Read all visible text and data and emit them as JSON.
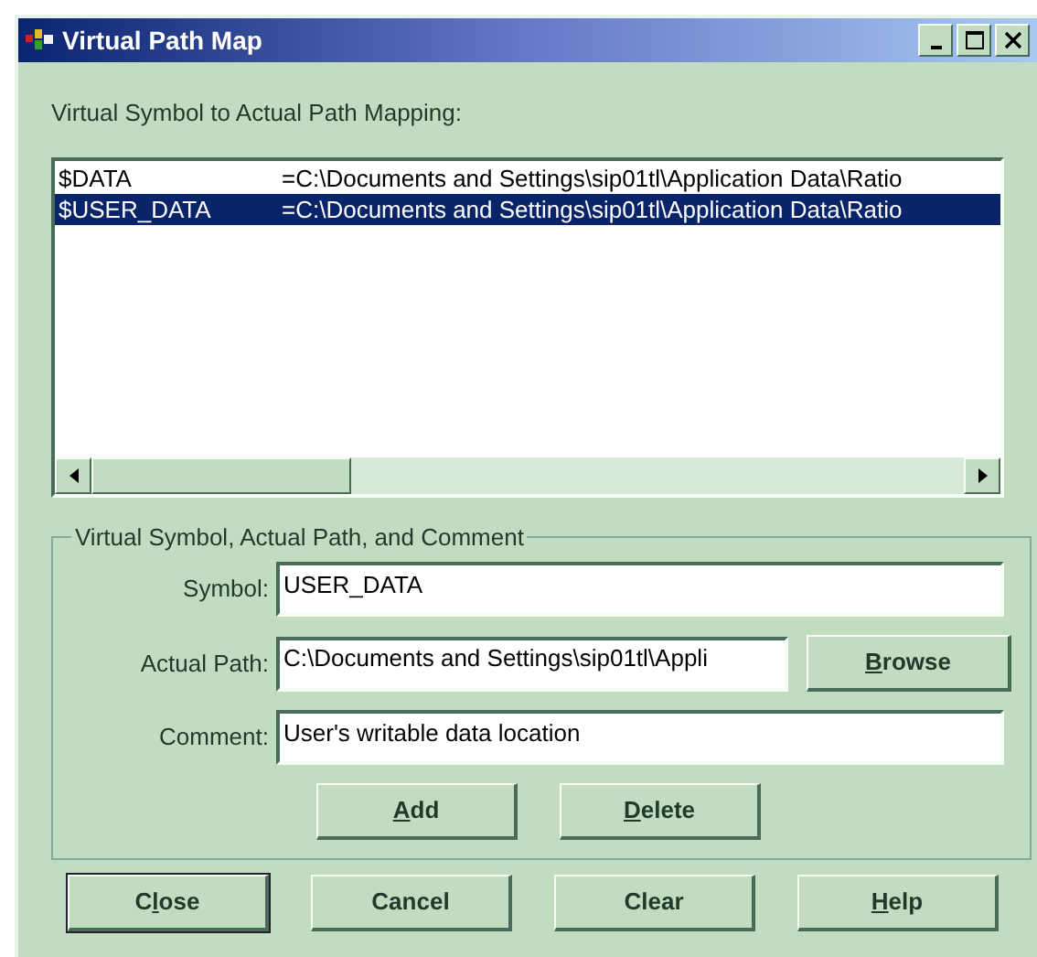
{
  "window": {
    "title": "Virtual Path Map"
  },
  "list_label": "Virtual Symbol to Actual Path Mapping:",
  "mappings": [
    {
      "symbol": "$DATA",
      "path": "=C:\\Documents and Settings\\sip01tl\\Application Data\\Ratio",
      "selected": false
    },
    {
      "symbol": "$USER_DATA",
      "path": "=C:\\Documents and Settings\\sip01tl\\Application Data\\Ratio",
      "selected": true
    }
  ],
  "group": {
    "title": "Virtual Symbol, Actual Path, and Comment",
    "fields": [
      {
        "label": "Symbol:",
        "value": "USER_DATA",
        "kind": "full"
      },
      {
        "label": "Actual Path:",
        "value": "C:\\Documents and Settings\\sip01tl\\Appli",
        "kind": "browse",
        "button": {
          "key": "B",
          "after": "rowse"
        }
      },
      {
        "label": "Comment:",
        "value": "User's writable data location",
        "kind": "full"
      }
    ],
    "buttons": [
      {
        "key": "A",
        "after": "dd"
      },
      {
        "key": "D",
        "after": "elete"
      }
    ]
  },
  "buttons": [
    {
      "label": {
        "before": "C",
        "key": "l",
        "after": "ose"
      },
      "default": true
    },
    {
      "label": {
        "before": "Cancel"
      },
      "default": false
    },
    {
      "label": {
        "before": "Clear"
      },
      "default": false
    },
    {
      "label": {
        "key": "H",
        "after": "elp"
      },
      "default": false
    }
  ]
}
